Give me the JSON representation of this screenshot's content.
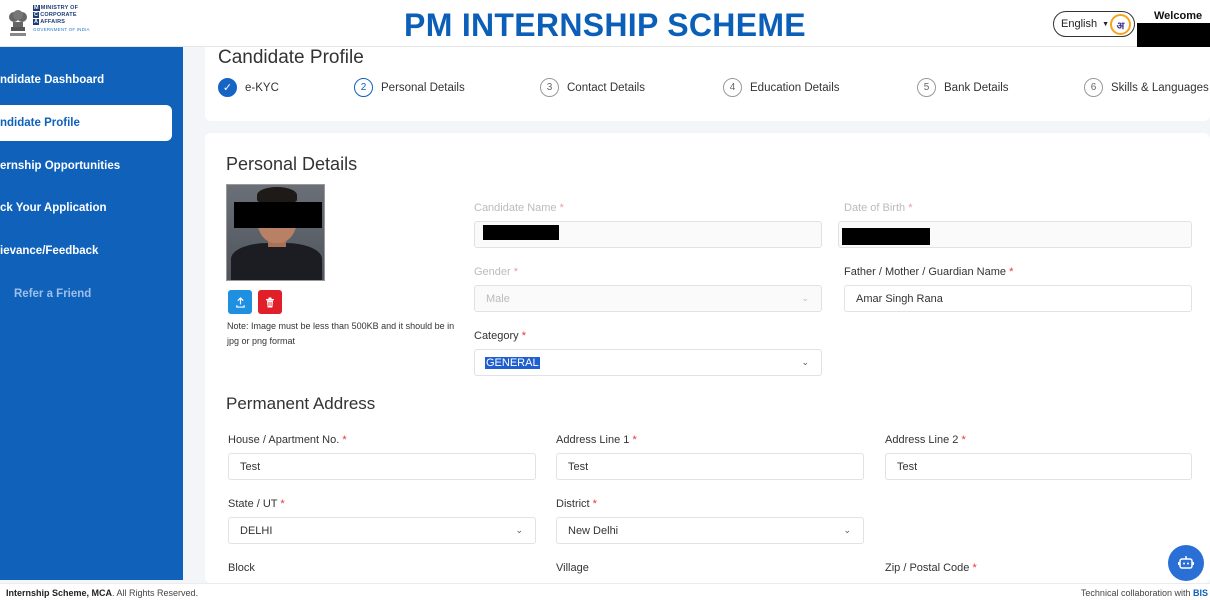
{
  "header": {
    "ministry_lines": [
      "MINISTRY OF",
      "CORPORATE",
      "AFFAIRS"
    ],
    "ministry_initials": [
      "M",
      "C",
      "A"
    ],
    "government": "GOVERNMENT OF INDIA",
    "title": "PM INTERNSHIP SCHEME",
    "language": "English",
    "welcome": "Welcome"
  },
  "sidebar": {
    "items": [
      {
        "label": "ndidate Dashboard"
      },
      {
        "label": "ndidate Profile"
      },
      {
        "label": "ernship Opportunities"
      },
      {
        "label": "ck Your Application"
      },
      {
        "label": "ievance/Feedback"
      },
      {
        "label": "Refer a Friend"
      }
    ]
  },
  "profile": {
    "title": "Candidate Profile",
    "steps": [
      {
        "num": "✓",
        "label": "e-KYC",
        "status": "done"
      },
      {
        "num": "2",
        "label": "Personal Details",
        "status": "current"
      },
      {
        "num": "3",
        "label": "Contact Details",
        "status": "pending"
      },
      {
        "num": "4",
        "label": "Education Details",
        "status": "pending"
      },
      {
        "num": "5",
        "label": "Bank Details",
        "status": "pending"
      },
      {
        "num": "6",
        "label": "Skills & Languages",
        "status": "pending"
      }
    ]
  },
  "personal": {
    "title": "Personal Details",
    "note": "Note: Image must be less than 500KB and it should be in jpg or png format",
    "candidate_name_label": "Candidate Name",
    "dob_label": "Date of Birth",
    "gender_label": "Gender",
    "gender_value": "Male",
    "guardian_label": "Father / Mother / Guardian Name",
    "guardian_value": "Amar Singh Rana",
    "category_label": "Category",
    "category_value": "GENERAL",
    "required_mark": "*"
  },
  "address": {
    "title": "Permanent Address",
    "house_label": "House / Apartment No.",
    "house_value": "Test",
    "line1_label": "Address Line 1",
    "line1_value": "Test",
    "line2_label": "Address Line 2",
    "line2_value": "Test",
    "state_label": "State / UT",
    "state_value": "DELHI",
    "district_label": "District",
    "district_value": "New Delhi",
    "block_label": "Block",
    "village_label": "Village",
    "zip_label": "Zip / Postal Code"
  },
  "footer": {
    "left_bold": "Internship Scheme, MCA",
    "left_rest": ". All Rights Reserved.",
    "right_text": "Technical collaboration with ",
    "right_bold": "BIS"
  },
  "colors": {
    "primary": "#0f61ba",
    "required": "#e33333",
    "delete": "#e01f28",
    "upload": "#1f8fe0"
  },
  "icons": [
    "check-icon",
    "upload-icon",
    "trash-icon",
    "chevron-down-icon",
    "chat-bot-icon",
    "refer-icon"
  ]
}
